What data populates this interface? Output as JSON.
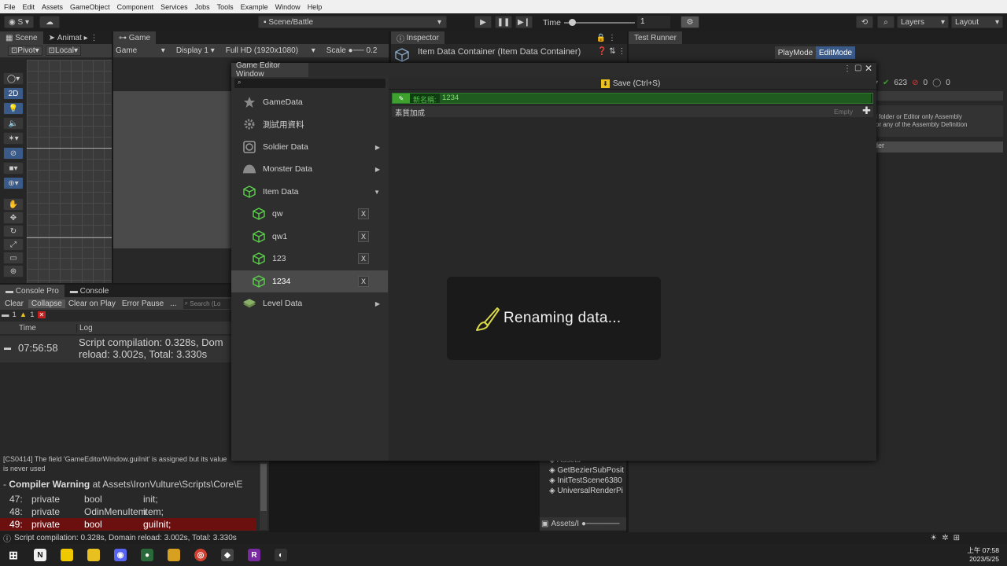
{
  "menubar": [
    "File",
    "Edit",
    "Assets",
    "GameObject",
    "Component",
    "Services",
    "Jobs",
    "Tools",
    "Example",
    "Window",
    "Help"
  ],
  "toolbar": {
    "account": "S",
    "scene_path": "Scene/Battle",
    "time_label": "Time",
    "time_value": "1",
    "layers": "Layers",
    "layout": "Layout"
  },
  "scene_panel": {
    "tabs": [
      "Scene",
      "Animat"
    ],
    "pivot": "Pivot",
    "local": "Local",
    "mode_2d": "2D"
  },
  "game_panel": {
    "tab": "Game",
    "view": "Game",
    "display": "Display 1",
    "resolution": "Full HD (1920x1080)",
    "scale_label": "Scale",
    "scale_value": "0.2"
  },
  "inspector": {
    "tab": "Inspector",
    "title": "Item Data Container (Item Data Container)"
  },
  "test_runner": {
    "tab": "Test Runner",
    "playmode": "PlayMode",
    "editmode": "EditMode",
    "pass_count": "623",
    "fail_count": "0",
    "other_count": "0",
    "note_line1": "l folder or Editor only Assembly",
    "note_line2": "or any of the Assembly Definition",
    "fragment1": "der"
  },
  "editor_window": {
    "title": "Game Editor Window",
    "save_label": "Save (Ctrl+S)",
    "rename_label": "新名稱:",
    "rename_value": "1234",
    "attr_label": "素質加成",
    "attr_empty": "Empty",
    "menu": [
      {
        "label": "GameData",
        "icon": "star-icon"
      },
      {
        "label": "測試用資料",
        "icon": "gear-icon"
      },
      {
        "label": "Soldier Data",
        "icon": "soldier-icon",
        "arrow": "▶"
      },
      {
        "label": "Monster Data",
        "icon": "monster-icon",
        "arrow": "▶"
      },
      {
        "label": "Item Data",
        "icon": "cube-icon",
        "arrow": "▼"
      },
      {
        "label": "qw",
        "icon": "cube-icon",
        "x": "X"
      },
      {
        "label": "qw1",
        "icon": "cube-icon",
        "x": "X"
      },
      {
        "label": "123",
        "icon": "cube-icon",
        "x": "X"
      },
      {
        "label": "1234",
        "icon": "cube-icon",
        "x": "X"
      },
      {
        "label": "Level Data",
        "icon": "level-icon",
        "arrow": "▶"
      }
    ],
    "toast": "Renaming data..."
  },
  "console": {
    "tabs": [
      "Console Pro",
      "Console"
    ],
    "buttons": [
      "Clear",
      "Collapse",
      "Clear on Play",
      "Error Pause",
      "..."
    ],
    "search_placeholder": "Search (Lo",
    "info_count": "1",
    "warn_count": "1",
    "col_time": "Time",
    "col_log": "Log",
    "entry_time": "07:56:58",
    "entry_line1": "Script compilation: 0.328s, Dom",
    "entry_line2": "reload: 3.002s, Total: 3.330s",
    "detail_line1": "[CS0414] The field 'GameEditorWindow.guiInit' is assigned but its value",
    "detail_line2": "is never used",
    "warning_label": "Compiler Warning",
    "warning_path": " at Assets\\IronVulture\\Scripts\\Core\\E",
    "code": [
      {
        "num": "47:",
        "kw": "private",
        "type": "bool",
        "name": "init;"
      },
      {
        "num": "48:",
        "kw": "private",
        "type": "OdinMenuItem",
        "name": "item;"
      },
      {
        "num": "49:",
        "kw": "private",
        "type": "bool",
        "name": "guiInit;"
      }
    ]
  },
  "project": {
    "items": [
      "Assets",
      "GetBezierSubPosit",
      "InitTestScene6380",
      "UniversalRenderPi"
    ],
    "footer": "Assets/I"
  },
  "statusbar": "Script compilation: 0.328s, Domain reload: 3.002s, Total: 3.330s",
  "taskbar": {
    "clock_line1": "上午 07:58",
    "clock_line2": "2023/5/25"
  },
  "colors": {
    "accent_green": "#3ea02d",
    "rename_bg": "#0f3d0f",
    "error_row": "#6b0f0f",
    "edit_mode_blue": "#3a5a8a"
  }
}
